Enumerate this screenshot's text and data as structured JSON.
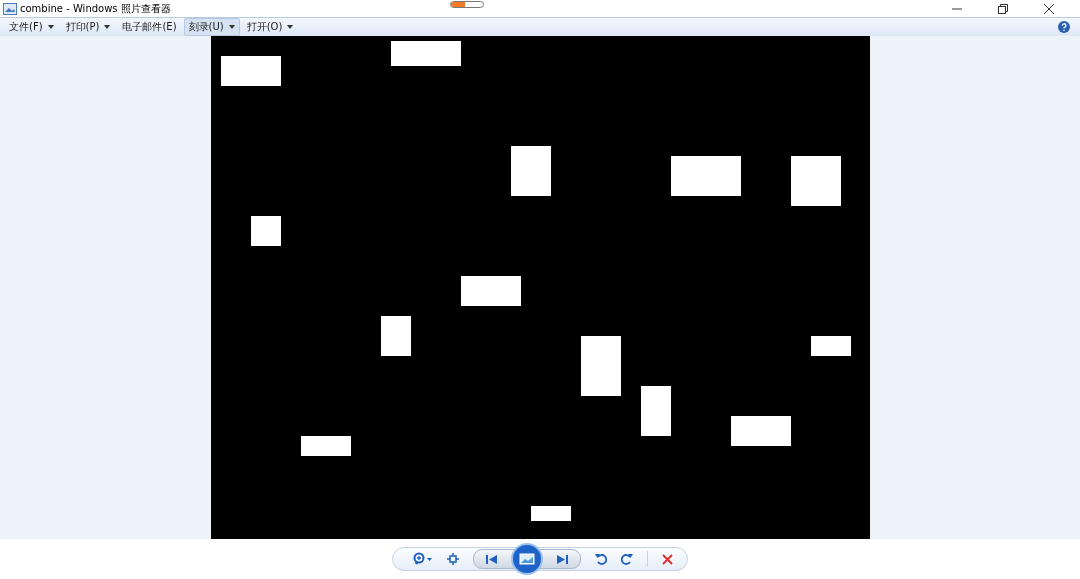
{
  "window": {
    "title": "combine - Windows 照片查看器"
  },
  "top_indicator": {
    "level": 0.45
  },
  "menu": [
    {
      "label": "文件(F)",
      "dropdown": true,
      "selected": false
    },
    {
      "label": "打印(P)",
      "dropdown": true,
      "selected": false
    },
    {
      "label": "电子邮件(E)",
      "dropdown": false,
      "selected": false
    },
    {
      "label": "刻录(U)",
      "dropdown": true,
      "selected": true
    },
    {
      "label": "打开(O)",
      "dropdown": true,
      "selected": false
    }
  ]
}
